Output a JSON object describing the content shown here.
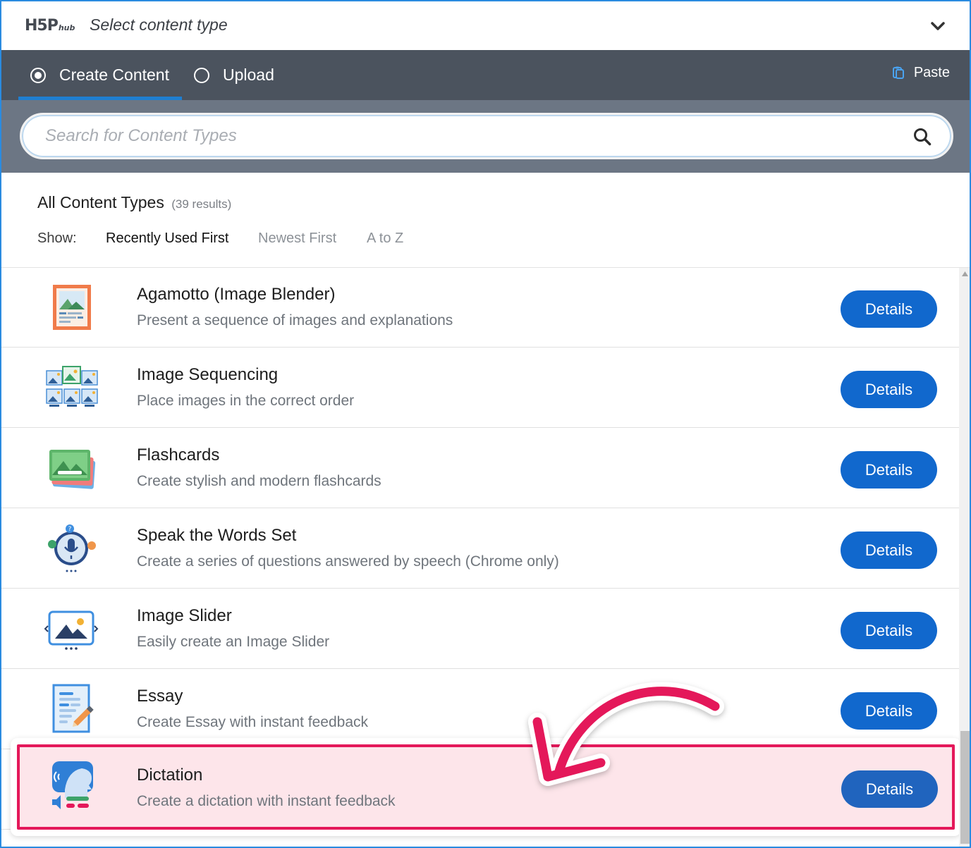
{
  "header": {
    "logo_main": "H5P",
    "logo_sub": "hub",
    "title": "Select content type"
  },
  "tabs": {
    "create_label": "Create Content",
    "upload_label": "Upload",
    "paste_label": "Paste"
  },
  "search": {
    "placeholder": "Search for Content Types",
    "value": ""
  },
  "listing": {
    "title": "All Content Types",
    "count": "(39 results)",
    "show_label": "Show:",
    "sort_options": [
      "Recently Used First",
      "Newest First",
      "A to Z"
    ],
    "active_sort": "Recently Used First"
  },
  "items": [
    {
      "name": "Agamotto (Image Blender)",
      "desc": "Present a sequence of images and explanations",
      "button": "Details",
      "icon": "agamotto-icon"
    },
    {
      "name": "Image Sequencing",
      "desc": "Place images in the correct order",
      "button": "Details",
      "icon": "image-sequencing-icon"
    },
    {
      "name": "Flashcards",
      "desc": "Create stylish and modern flashcards",
      "button": "Details",
      "icon": "flashcards-icon"
    },
    {
      "name": "Speak the Words Set",
      "desc": "Create a series of questions answered by speech (Chrome only)",
      "button": "Details",
      "icon": "speak-words-icon"
    },
    {
      "name": "Image Slider",
      "desc": "Easily create an Image Slider",
      "button": "Details",
      "icon": "image-slider-icon"
    },
    {
      "name": "Essay",
      "desc": "Create Essay with instant feedback",
      "button": "Details",
      "icon": "essay-icon"
    },
    {
      "name": "Dictation",
      "desc": "Create a dictation with instant feedback",
      "button": "Details",
      "icon": "dictation-icon",
      "highlighted": true
    }
  ],
  "colors": {
    "tabbar": "#4b535e",
    "searchband": "#6c7684",
    "accent": "#1168cd",
    "highlight_border": "#e4185a",
    "highlight_fill": "#fde5ea"
  }
}
